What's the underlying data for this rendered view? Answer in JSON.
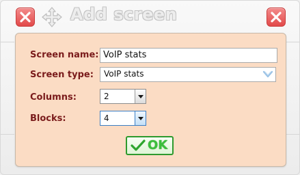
{
  "dialog": {
    "title": "Add screen",
    "ok_label": "OK"
  },
  "icons": {
    "close_left": "close-icon",
    "close_right": "close-icon",
    "move": "move-icon",
    "ok_check": "check-icon",
    "select_chevron": "chevron-down-icon"
  },
  "form": {
    "screen_name": {
      "label": "Screen name:",
      "value": "VoIP stats"
    },
    "screen_type": {
      "label": "Screen type:",
      "value": "VoIP stats"
    },
    "columns": {
      "label": "Columns:",
      "value": "2"
    },
    "blocks": {
      "label": "Blocks:",
      "value": "4"
    }
  },
  "colors": {
    "panel_bg": "#fbdcc4",
    "label_text": "#7a1b1b",
    "close_red": "#e24a4a",
    "ok_green": "#3bbf3b"
  }
}
